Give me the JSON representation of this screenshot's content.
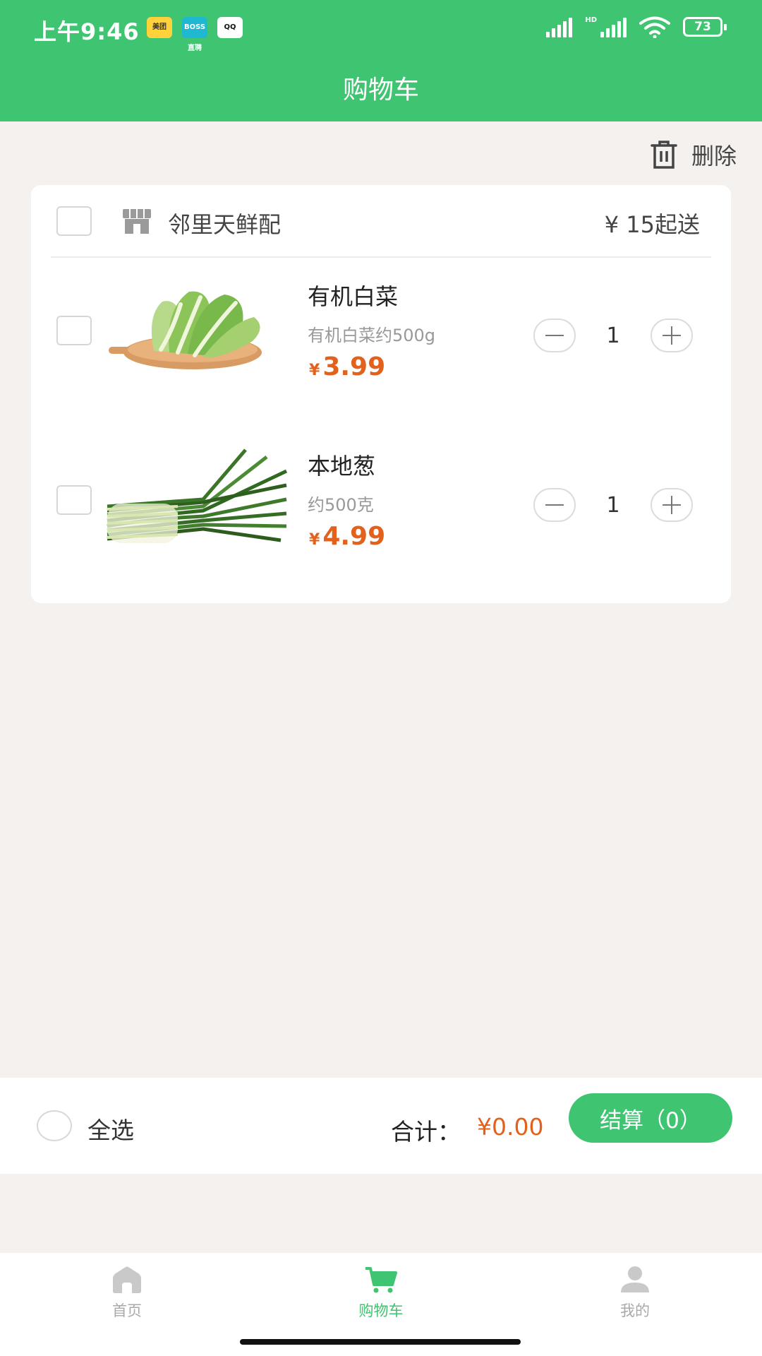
{
  "status_bar": {
    "time": "上午9:46",
    "notifications": [
      "美团",
      "BOSS直聘",
      "QQ"
    ],
    "battery": "73"
  },
  "header": {
    "title": "购物车"
  },
  "toolbar": {
    "delete_label": "删除"
  },
  "store": {
    "name": "邻里天鲜配",
    "min_order": "¥ 15起送",
    "items": [
      {
        "name": "有机白菜",
        "desc": "有机白菜约500g",
        "currency": "¥",
        "price": "3.99",
        "quantity": "1",
        "image": "bok-choy-on-cutting-board"
      },
      {
        "name": "本地葱",
        "desc": "约500克",
        "currency": "¥",
        "price": "4.99",
        "quantity": "1",
        "image": "green-onion-bunch"
      }
    ]
  },
  "checkout": {
    "select_all_label": "全选",
    "total_label": "合计：",
    "total_value": "¥0.00",
    "button_label": "结算（0）"
  },
  "tabbar": {
    "tabs": [
      {
        "label": "首页",
        "icon": "home-icon",
        "active": false
      },
      {
        "label": "购物车",
        "icon": "cart-icon",
        "active": true
      },
      {
        "label": "我的",
        "icon": "user-icon",
        "active": false
      }
    ]
  },
  "colors": {
    "brand_green": "#3fc571",
    "price_orange": "#e2611d",
    "background": "#f4f1ee"
  }
}
